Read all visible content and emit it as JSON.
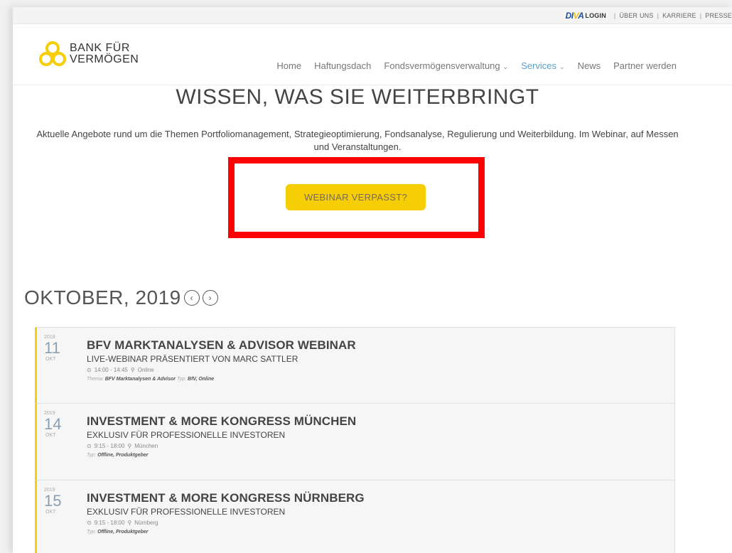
{
  "topbar": {
    "diva_logo": "DIVA",
    "login": "LOGIN",
    "links": [
      "ÜBER UNS",
      "KARRIERE",
      "PRESSE"
    ]
  },
  "logo": {
    "line1": "BANK FÜR",
    "line2": "VERMÖGEN",
    "color": "#f6ce06"
  },
  "nav": [
    {
      "label": "Home"
    },
    {
      "label": "Haftungsdach"
    },
    {
      "label": "Fondsvermögensverwaltung"
    },
    {
      "label": "Services"
    },
    {
      "label": "News"
    },
    {
      "label": "Partner werden"
    }
  ],
  "hero": {
    "title": "WISSEN, WAS SIE WEITERBRINGT",
    "description": "Aktuelle Angebote rund um die Themen Portfoliomanagement, Strategieoptimierung, Fondsanalyse, Regulierung und Weiterbildung.  Im Webinar, auf Messen und Veranstaltungen.",
    "button": "WEBINAR VERPASST?"
  },
  "month": {
    "label": "OKTOBER, 2019",
    "prev": "‹",
    "next": "›"
  },
  "events": [
    {
      "year": "2019",
      "day": "11",
      "month": "OKT",
      "title": "BFV MARKTANALYSEN & ADVISOR WEBINAR",
      "subtitle": "LIVE-WEBINAR PRÄSENTIERT VON MARC SATTLER",
      "time": "14:00 - 14:45",
      "location": "Online",
      "tag_label_1": "Thema:",
      "tag_value_1": "BFV Marktanalysen & Advisor",
      "tag_label_2": "Typ:",
      "tag_value_2": "BfV,  Online"
    },
    {
      "year": "2019",
      "day": "14",
      "month": "OKT",
      "title": "INVESTMENT & MORE KONGRESS MÜNCHEN",
      "subtitle": "EXKLUSIV FÜR PROFESSIONELLE INVESTOREN",
      "time": "9:15 - 18:00",
      "location": "München",
      "tag_label_1": "",
      "tag_value_1": "",
      "tag_label_2": "Typ:",
      "tag_value_2": "Offline,  Produktgeber"
    },
    {
      "year": "2019",
      "day": "15",
      "month": "OKT",
      "title": "INVESTMENT & MORE KONGRESS NÜRNBERG",
      "subtitle": "EXKLUSIV FÜR PROFESSIONELLE INVESTOREN",
      "time": "9:15 - 18:00",
      "location": "Nürnberg",
      "tag_label_1": "",
      "tag_value_1": "",
      "tag_label_2": "Typ:",
      "tag_value_2": "Offline,  Produktgeber"
    }
  ]
}
